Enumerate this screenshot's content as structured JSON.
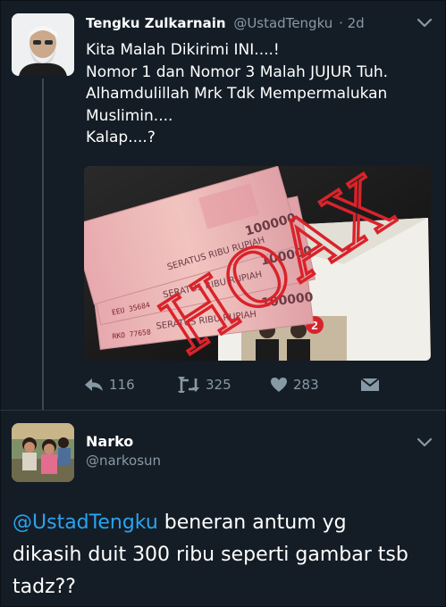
{
  "tweet1": {
    "author_name": "Tengku Zulkarnain",
    "author_handle": "@UstadTengku",
    "time": "· 2d",
    "lines": [
      "Kita Malah Dikirimi INI....!",
      "Nomor 1 dan Nomor 3 Malah JUJUR Tuh.",
      "Alhamdulillah Mrk Tdk Mempermalukan",
      "Muslimin....",
      "Kalap....?"
    ],
    "image": {
      "stamp_text": "HOAX",
      "note_texts": [
        "SERATUS RIBU RUPIAH",
        "SERATUS RIBU RUPIAH",
        "SERATUS RIBU RUPIAH",
        "100000",
        "100000",
        "100000"
      ],
      "serials": [
        "EEU 35684",
        "RKO 77658"
      ],
      "envelope_number": "2"
    },
    "replies": "116",
    "retweets": "325",
    "likes": "283"
  },
  "tweet2": {
    "author_name": "Narko",
    "author_handle": "@narkosun",
    "mention": "@UstadTengku",
    "line1_rest": " beneran antum yg",
    "line2": "dikasih duit 300 ribu seperti gambar tsb",
    "line3": "tadz??"
  },
  "colors": {
    "background": "#141d26",
    "muted": "#8899a6",
    "link": "#2aa3ef",
    "hoax_red": "#d9232a"
  }
}
